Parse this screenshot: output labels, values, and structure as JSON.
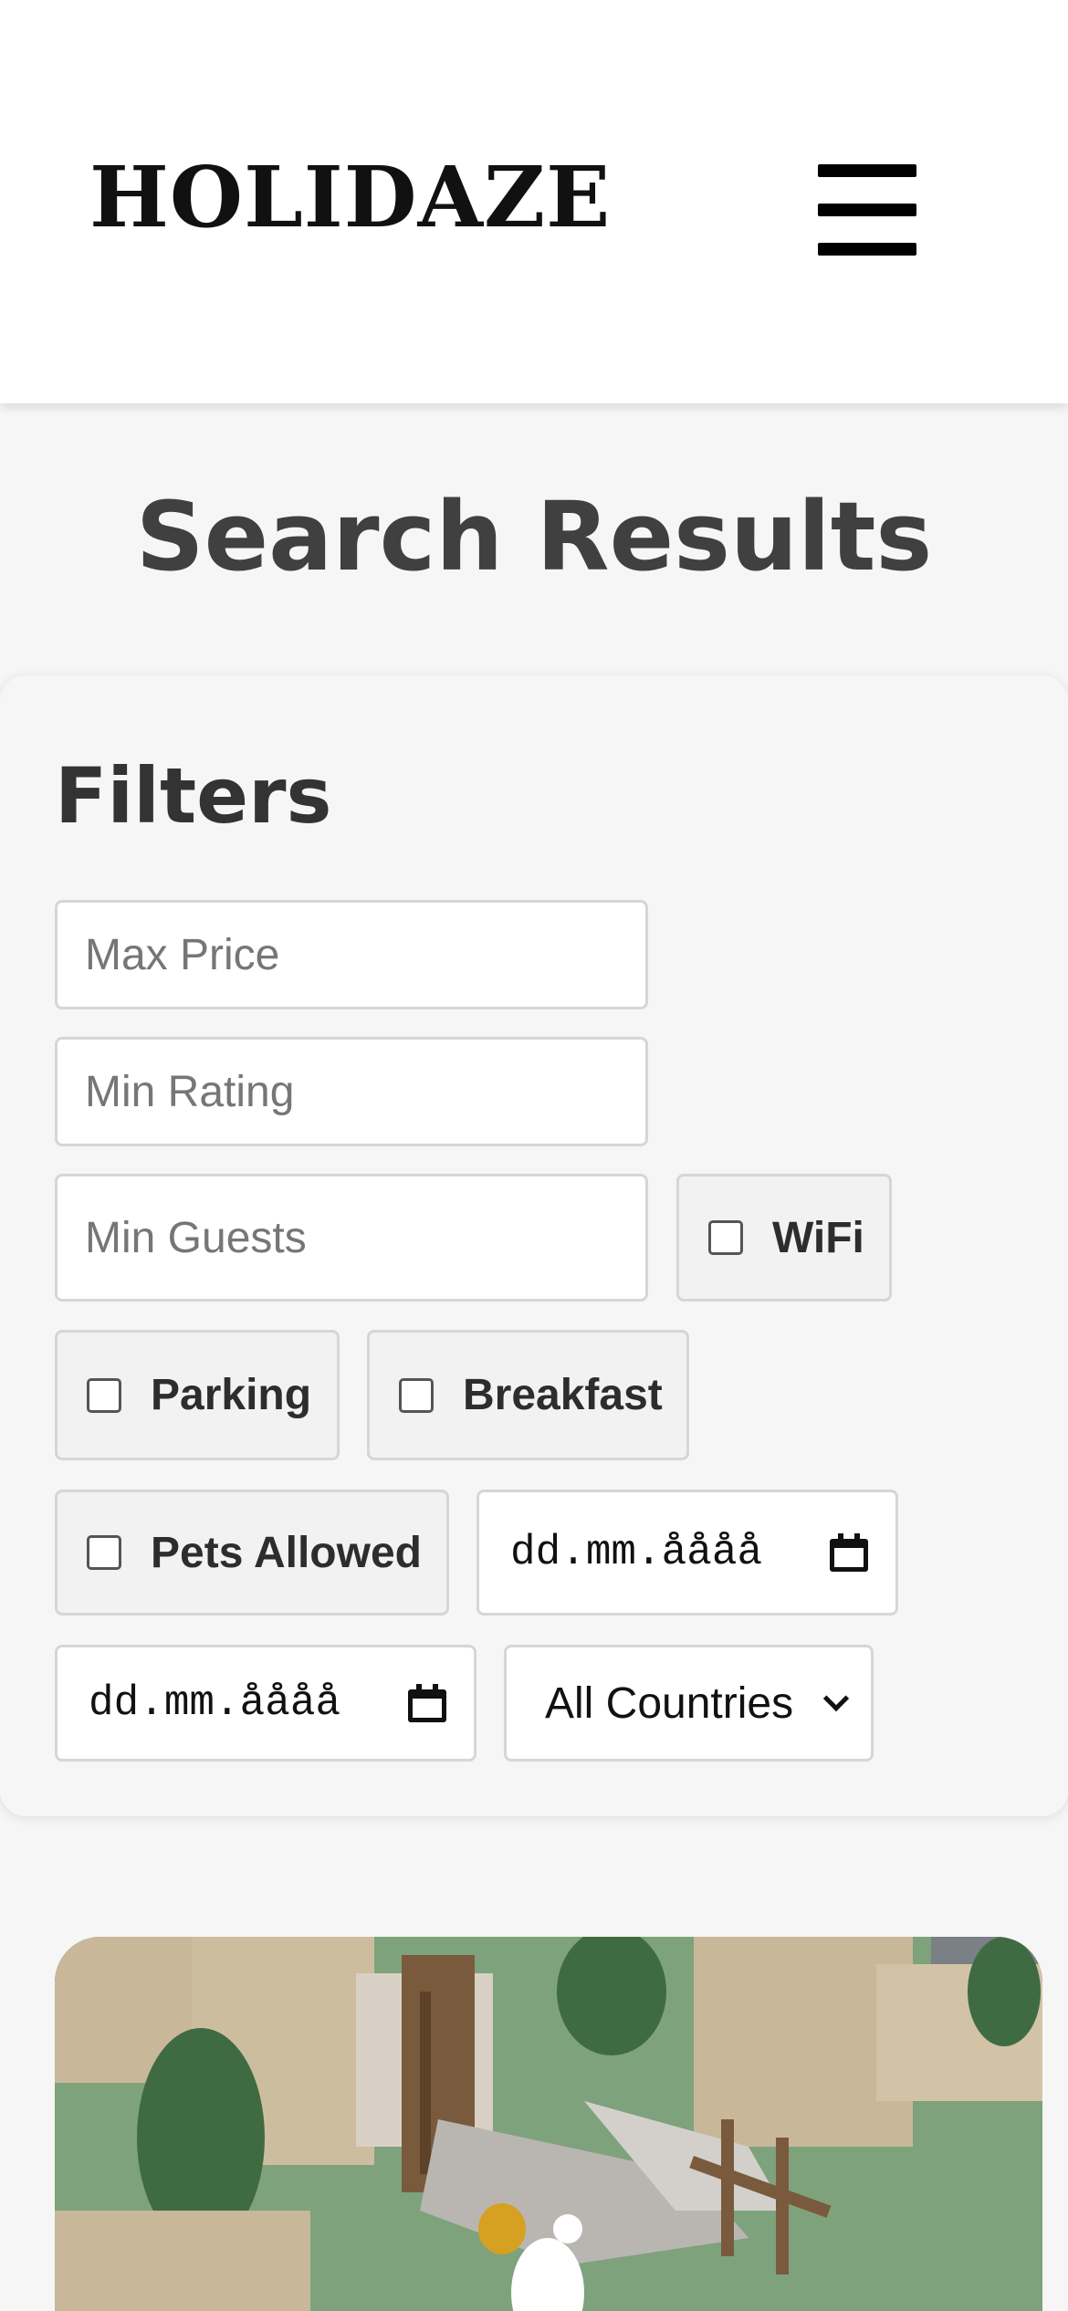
{
  "header": {
    "logo": "HOLIDAZE",
    "menu_icon": "hamburger-menu-icon"
  },
  "page": {
    "title": "Search Results"
  },
  "filters": {
    "title": "Filters",
    "max_price_placeholder": "Max Price",
    "min_rating_placeholder": "Min Rating",
    "min_guests_placeholder": "Min Guests",
    "amenities": {
      "wifi": "WiFi",
      "parking": "Parking",
      "breakfast": "Breakfast",
      "pets": "Pets Allowed"
    },
    "date_from": "dd.mm.åååå",
    "date_to": "dd.mm.åååå",
    "calendar_icon": "calendar-icon",
    "country_select": "All Countries",
    "chevron_icon": "chevron-down-icon"
  },
  "card": {
    "image_description_icon": "venue-image"
  },
  "colors": {
    "header_bg": "#ffffff",
    "page_bg": "#f6f6f6",
    "title_text": "#404040"
  }
}
